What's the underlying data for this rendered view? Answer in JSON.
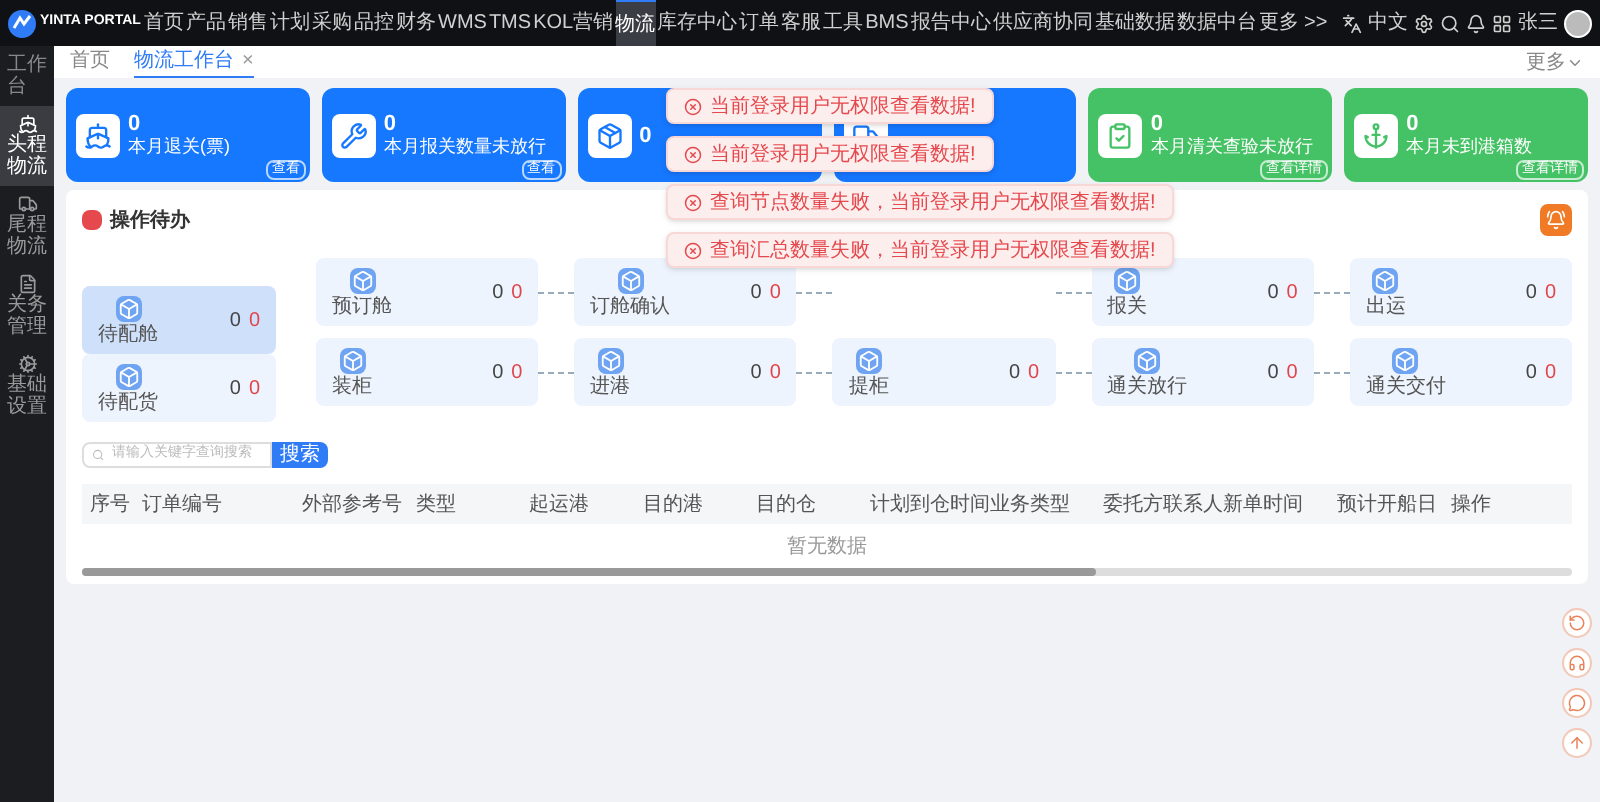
{
  "header": {
    "brand": "YINTA PORTAL",
    "menu": [
      {
        "label": "首页",
        "selected": false
      },
      {
        "label": "产品",
        "selected": false
      },
      {
        "label": "销售",
        "selected": false
      },
      {
        "label": "计划",
        "selected": false
      },
      {
        "label": "采购",
        "selected": false
      },
      {
        "label": "品控",
        "selected": false
      },
      {
        "label": "财务",
        "selected": false
      },
      {
        "label": "WMS",
        "selected": false
      },
      {
        "label": "TMS",
        "selected": false
      },
      {
        "label": "KOL营销",
        "selected": false
      },
      {
        "label": "物流",
        "selected": true
      },
      {
        "label": "库存中心",
        "selected": false
      },
      {
        "label": "订单",
        "selected": false
      },
      {
        "label": "客服",
        "selected": false
      },
      {
        "label": "工具",
        "selected": false
      },
      {
        "label": "BMS",
        "selected": false
      },
      {
        "label": "报告中心",
        "selected": false
      },
      {
        "label": "供应商协同",
        "selected": false
      },
      {
        "label": "基础数据",
        "selected": false
      },
      {
        "label": "数据中台",
        "selected": false
      },
      {
        "label": "更多 >>",
        "selected": false
      }
    ],
    "language": "中文",
    "user": "张三"
  },
  "sidebar": {
    "title": "工作台",
    "items": [
      {
        "label": "头程物流",
        "selected": true
      },
      {
        "label": "尾程物流",
        "selected": false
      },
      {
        "label": "关务管理",
        "selected": false
      },
      {
        "label": "基础设置",
        "selected": false
      }
    ]
  },
  "tabs": {
    "items": [
      {
        "label": "首页",
        "selected": false
      },
      {
        "label": "物流工作台",
        "selected": true,
        "close": "×"
      }
    ],
    "more": "更多"
  },
  "cards": [
    {
      "value": "0",
      "label": "本月退关(票)",
      "action": "查看",
      "color": "#1677ff"
    },
    {
      "value": "0",
      "label": "本月报关数量未放行",
      "action": "查看",
      "color": "#1677ff"
    },
    {
      "value": "0",
      "color": "#1677ff"
    },
    {
      "color": "#1677ff"
    },
    {
      "value": "0",
      "label": "本月清关查验未放行",
      "action": "查看详情",
      "color": "#45c265"
    },
    {
      "value": "0",
      "label": "本月未到港箱数",
      "action": "查看详情",
      "color": "#45c265"
    }
  ],
  "toasts": [
    {
      "message": "当前登录用户无权限查看数据!"
    },
    {
      "message": "当前登录用户无权限查看数据!"
    },
    {
      "message": "查询节点数量失败，当前登录用户无权限查看数据!"
    },
    {
      "message": "查询汇总数量失败，当前登录用户无权限查看数据!"
    }
  ],
  "todo": {
    "title": "操作待办",
    "side": [
      {
        "label": "待配舱",
        "count": "0",
        "alert": "0",
        "selected": true
      },
      {
        "label": "待配货",
        "count": "0",
        "alert": "0",
        "selected": false
      }
    ],
    "rows": [
      [
        {
          "label": "预订舱",
          "count": "0",
          "alert": "0"
        },
        {
          "label": "订舱确认",
          "count": "0",
          "alert": "0"
        },
        "",
        {
          "label": "报关",
          "count": "0",
          "alert": "0"
        },
        {
          "label": "出运",
          "count": "0",
          "alert": "0"
        }
      ],
      [
        {
          "label": "装柜",
          "count": "0",
          "alert": "0"
        },
        {
          "label": "进港",
          "count": "0",
          "alert": "0"
        },
        {
          "label": "提柜",
          "count": "0",
          "alert": "0"
        },
        {
          "label": "通关放行",
          "count": "0",
          "alert": "0"
        },
        {
          "label": "通关交付",
          "count": "0",
          "alert": "0"
        }
      ]
    ]
  },
  "search": {
    "placeholder": "请输入关键字查询搜索",
    "button": "搜索"
  },
  "table": {
    "columns": [
      "序号",
      "订单编号",
      "外部参考号",
      "类型",
      "起运港",
      "目的港",
      "目的仓",
      "计划到仓时间",
      "业务类型",
      "委托方联系人",
      "新单时间",
      "预计开船日",
      "操作"
    ],
    "empty": "暂无数据"
  }
}
